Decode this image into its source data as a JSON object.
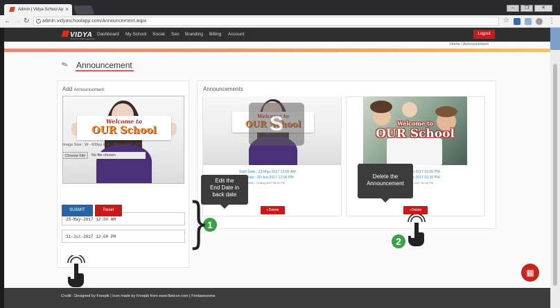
{
  "browser": {
    "tab_title": "Admin | Vidya School Ap",
    "url": "admin.vidyaschoolapp.com/Announcement.aspx",
    "window_controls": [
      "minimize",
      "restore",
      "close"
    ]
  },
  "navbar": {
    "logo": "VIDYA",
    "logo_subtitle": "School Management",
    "items": [
      "Dashboard",
      "My School",
      "Social",
      "Seo",
      "Branding",
      "Billing",
      "Account"
    ],
    "logout": "Logout"
  },
  "breadcrumb": "Home / Announcement",
  "page_title": "Announcement",
  "add_panel": {
    "heading": "Add",
    "heading_small": "Announcement",
    "image_hint": "Image Size : W - 600px & H - 350px MAX, JPG",
    "choose_file": "Choose File",
    "no_file": "No file chosen",
    "start_date": "25-May-2017 12:00 AM",
    "end_date": "31-Jul-2017 12:00 PM",
    "submit": "SUBMIT",
    "reset": "Reset"
  },
  "announcements": {
    "heading": "Announcements",
    "cards": [
      {
        "sign_line1": "Welcome to",
        "sign_line2": "OUR School",
        "start": "Start Date : 23-May-2017 12:00 AM",
        "end": "End Date : 30-Jun-2017 12:00 PM",
        "added": "Date Added : 23-May-2017 03:52 PM",
        "delete": "Delete"
      },
      {
        "sign_line1": "Welcome to",
        "sign_line2": "OUR School",
        "start": "pr-2017 03:00 PM",
        "end": "pr-2017 03:30 PM",
        "added": "pr-2017 02:45 PM",
        "delete": "Delete"
      }
    ]
  },
  "overlay_letter": "S",
  "tooltips": {
    "edit": [
      "Edit the",
      "End Date in",
      "back date"
    ],
    "delete": [
      "Delete the",
      "Announcement"
    ]
  },
  "steps": [
    "1",
    "2"
  ],
  "footer": "Credit : Designed by Freepik | Icon made by Freepik from www.flaticon.com | Fontawesome",
  "colors": {
    "navbar": "#2f2f2f",
    "danger": "#c81a1a",
    "primary": "#2a63a4",
    "step_green": "#3aa245",
    "tooltip": "#3b3b3b"
  }
}
